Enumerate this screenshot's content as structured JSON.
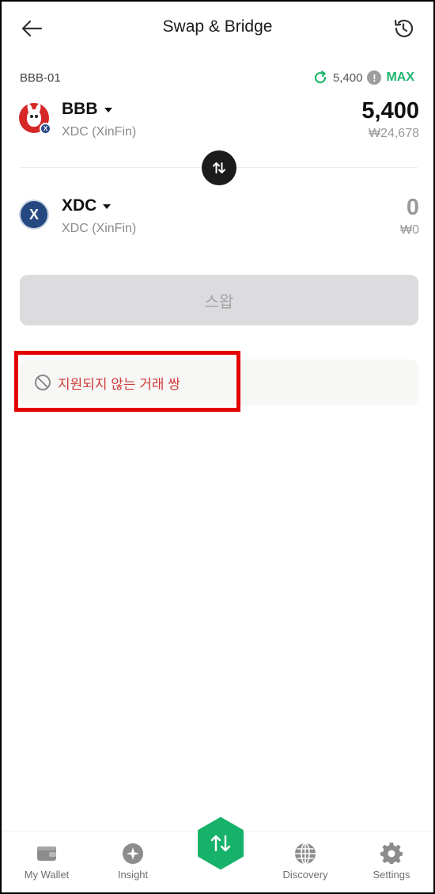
{
  "header": {
    "title": "Swap & Bridge",
    "back_icon": "arrow-left-icon",
    "history_icon": "history-icon"
  },
  "from": {
    "account_label": "BBB-01",
    "balance": "5,400",
    "max_label": "MAX",
    "token_symbol": "BBB",
    "token_chain": "XDC (XinFin)",
    "amount": "5,400",
    "fiat": "₩24,678"
  },
  "to": {
    "token_symbol": "XDC",
    "token_chain": "XDC (XinFin)",
    "amount": "0",
    "fiat": "₩0",
    "logo_letter": "X"
  },
  "swap_button_label": "스왑",
  "notice": {
    "text": "지원되지 않는 거래 쌍"
  },
  "nav": {
    "items": [
      {
        "label": "My Wallet",
        "icon": "wallet-icon"
      },
      {
        "label": "Insight",
        "icon": "insight-icon"
      },
      {
        "label": "Discovery",
        "icon": "globe-icon"
      },
      {
        "label": "Settings",
        "icon": "gear-icon"
      }
    ],
    "center_icon": "swap-icon"
  },
  "colors": {
    "accent_green": "#1db56b",
    "error_red": "#d03a3a",
    "highlight_red": "#e30000",
    "disabled_button": "#dcdcde"
  }
}
